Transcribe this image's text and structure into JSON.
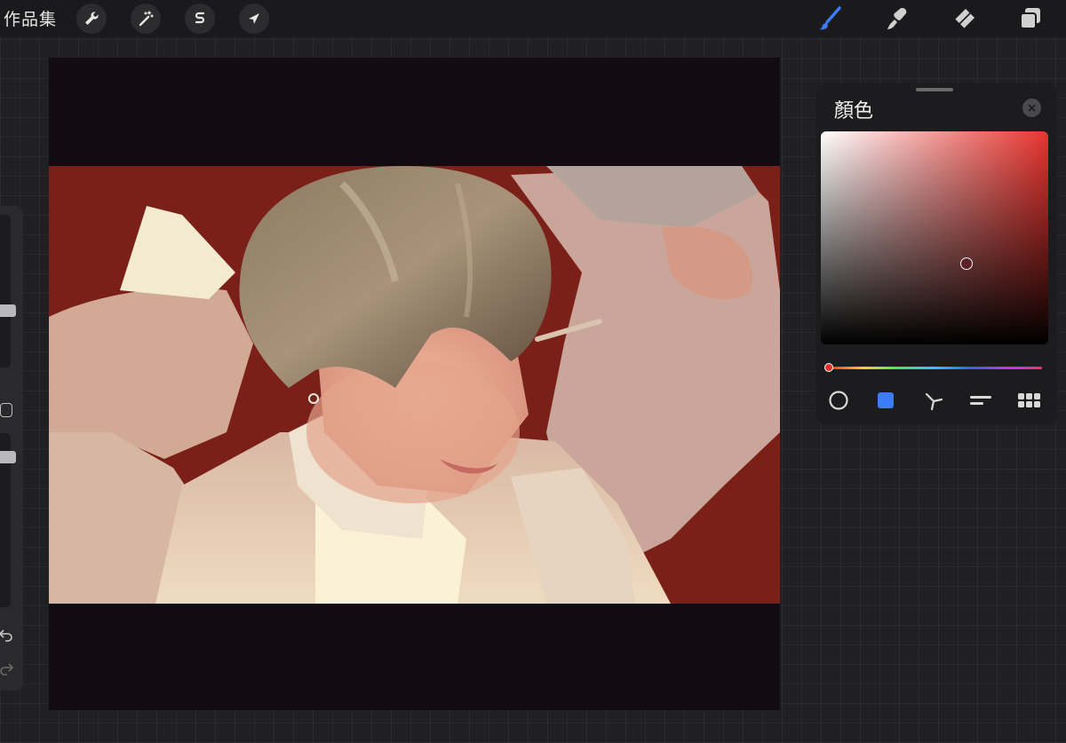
{
  "toolbar": {
    "gallery_label": "作品集",
    "left_tools": [
      {
        "name": "actions",
        "icon": "wrench-icon"
      },
      {
        "name": "adjustments",
        "icon": "magic-wand-icon"
      },
      {
        "name": "selection",
        "icon": "selection-s-icon"
      },
      {
        "name": "transform",
        "icon": "arrow-cursor-icon"
      }
    ],
    "right_tools": [
      {
        "name": "brush",
        "icon": "brush-icon",
        "active": true
      },
      {
        "name": "smudge",
        "icon": "smudge-icon",
        "active": false
      },
      {
        "name": "eraser",
        "icon": "eraser-icon",
        "active": false
      },
      {
        "name": "layers",
        "icon": "layers-icon",
        "active": false
      }
    ],
    "active_color": "#3d7bf7"
  },
  "sidebar": {
    "brush_size_level": 0.08,
    "opacity_level": 0.07,
    "icons": [
      "undo-icon",
      "redo-icon"
    ]
  },
  "canvas": {
    "background": "#120b12",
    "artwork_subject": "painting"
  },
  "color_panel": {
    "title": "顏色",
    "current_color": "#5c2226",
    "hue": "#e8342f",
    "saturation": 0.64,
    "brightness": 0.38,
    "modes": [
      {
        "name": "disc",
        "icon": "circle-icon",
        "active": false
      },
      {
        "name": "classic",
        "icon": "square-icon",
        "active": true
      },
      {
        "name": "harmony",
        "icon": "harmony-icon",
        "active": false
      },
      {
        "name": "value",
        "icon": "sliders-icon",
        "active": false
      },
      {
        "name": "palettes",
        "icon": "grid-icon",
        "active": false
      }
    ]
  }
}
